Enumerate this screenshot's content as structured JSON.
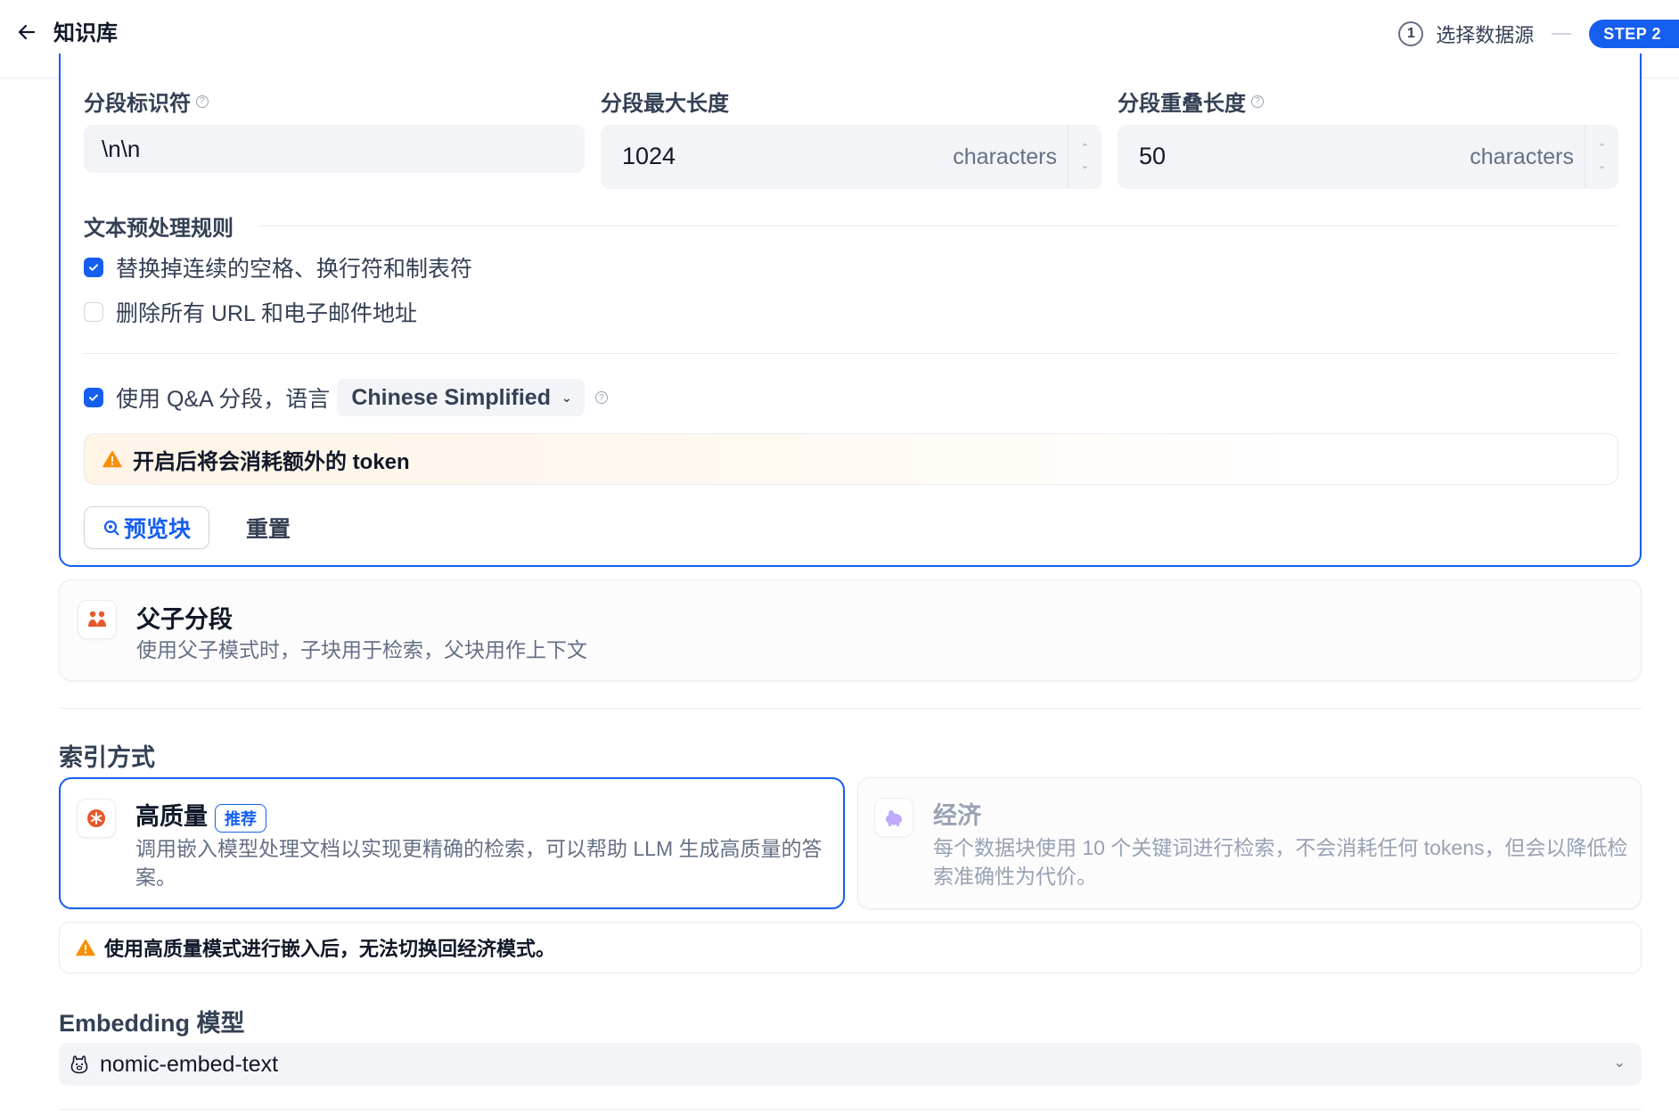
{
  "header": {
    "title": "知识库",
    "step1_num": "1",
    "step1_label": "选择数据源",
    "step2_badge": "STEP 2"
  },
  "segment": {
    "separator_label": "分段标识符",
    "separator_value": "\\n\\n",
    "max_length_label": "分段最大长度",
    "max_length_value": "1024",
    "max_length_unit": "characters",
    "overlap_label": "分段重叠长度",
    "overlap_value": "50",
    "overlap_unit": "characters",
    "preprocess_title": "文本预处理规则",
    "rule_replace_spaces": "替换掉连续的空格、换行符和制表符",
    "rule_replace_spaces_checked": true,
    "rule_remove_urls": "删除所有 URL 和电子邮件地址",
    "rule_remove_urls_checked": false,
    "qa_label": "使用 Q&A 分段，语言",
    "qa_checked": true,
    "qa_language": "Chinese Simplified",
    "token_warning": "开启后将会消耗额外的 token",
    "preview_button": "预览块",
    "reset_button": "重置"
  },
  "parent_child": {
    "title": "父子分段",
    "description": "使用父子模式时，子块用于检索，父块用作上下文"
  },
  "index": {
    "heading": "索引方式",
    "high_quality_title": "高质量",
    "high_quality_badge": "推荐",
    "high_quality_desc": "调用嵌入模型处理文档以实现更精确的检索，可以帮助 LLM 生成高质量的答案。",
    "economy_title": "经济",
    "economy_desc": "每个数据块使用 10 个关键词进行检索，不会消耗任何 tokens，但会以降低检索准确性为代价。",
    "switch_warning": "使用高质量模式进行嵌入后，无法切换回经济模式。"
  },
  "embedding": {
    "heading": "Embedding 模型",
    "model": "nomic-embed-text"
  },
  "colors": {
    "primary": "#155eef",
    "warning": "#f79009",
    "orange_icon": "#e6582b",
    "economy_icon": "#a48afb"
  }
}
